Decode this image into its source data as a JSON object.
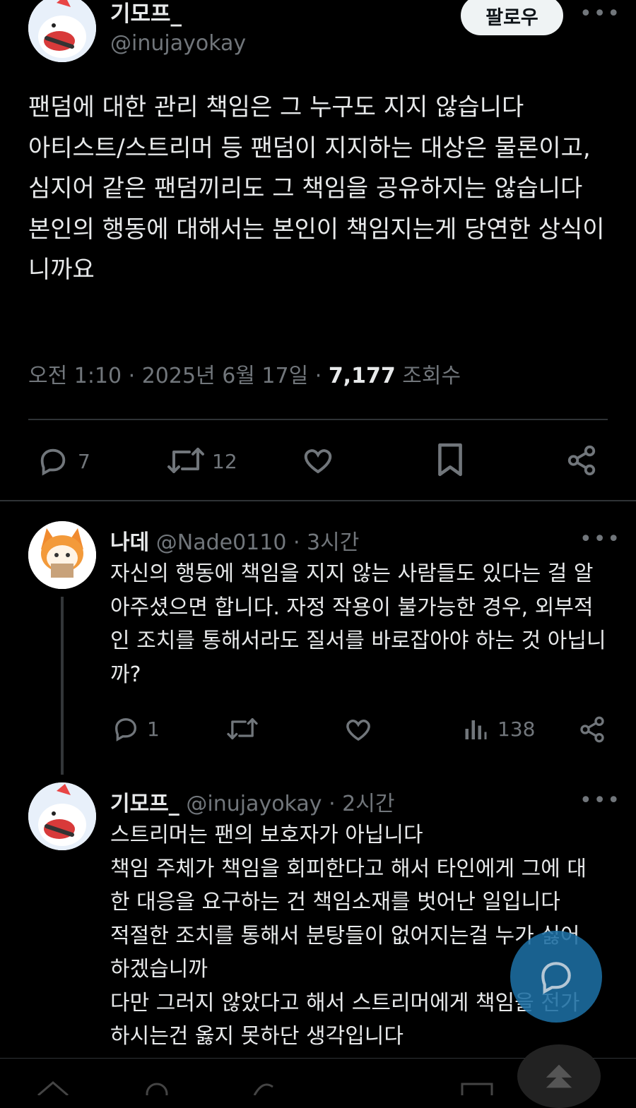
{
  "main_post": {
    "display_name": "기모프_",
    "handle": "@inujayokay",
    "follow_label": "팔로우",
    "more_icon": "more-horizontal-icon",
    "body": "팬덤에 대한 관리 책임은 그 누구도 지지 않습니다\n아티스트/스트리머 등 팬덤이 지지하는 대상은 물론이고, 심지어 같은 팬덤끼리도 그 책임을 공유하지는 않습니다\n본인의 행동에 대해서는 본인이 책임지는게 당연한 상식이니까요",
    "timestamp": "오전 1:10 · 2025년 6월 17일 · ",
    "views_count": "7,177",
    "views_label": " 조회수",
    "actions": {
      "reply_icon": "reply-icon",
      "reply_count": "7",
      "retweet_icon": "retweet-icon",
      "retweet_count": "12",
      "like_icon": "heart-icon",
      "bookmark_icon": "bookmark-icon",
      "share_icon": "share-icon"
    }
  },
  "replies": [
    {
      "display_name": "나데",
      "handle": "@Nade0110",
      "time": "· 3시간",
      "body": "자신의 행동에 책임을 지지 않는 사람들도 있다는 걸 알아주셨으면 합니다. 자정 작용이 불가능한 경우, 외부적인 조치를 통해서라도 질서를 바로잡아야 하는 것 아닙니까?",
      "reply_count": "1",
      "views_count": "138"
    },
    {
      "display_name": "기모프_",
      "handle": "@inujayokay",
      "time": "· 2시간",
      "body": "스트리머는 팬의 보호자가 아닙니다\n책임 주체가 책임을 회피한다고 해서 타인에게 그에 대한 대응을 요구하는 건 책임소재를 벗어난 일입니다\n적절한 조치를 통해서 분탕들이 없어지는걸 누가 싫어하겠습니까\n다만 그러지 않았다고 해서 스트리머에게 책임을 전가하시는건 옳지 못하단 생각입니다"
    }
  ],
  "colors": {
    "background": "#000000",
    "text": "#e7e9ea",
    "muted": "#71767b",
    "divider": "#2f3336",
    "fab": "#1d6fa3"
  }
}
